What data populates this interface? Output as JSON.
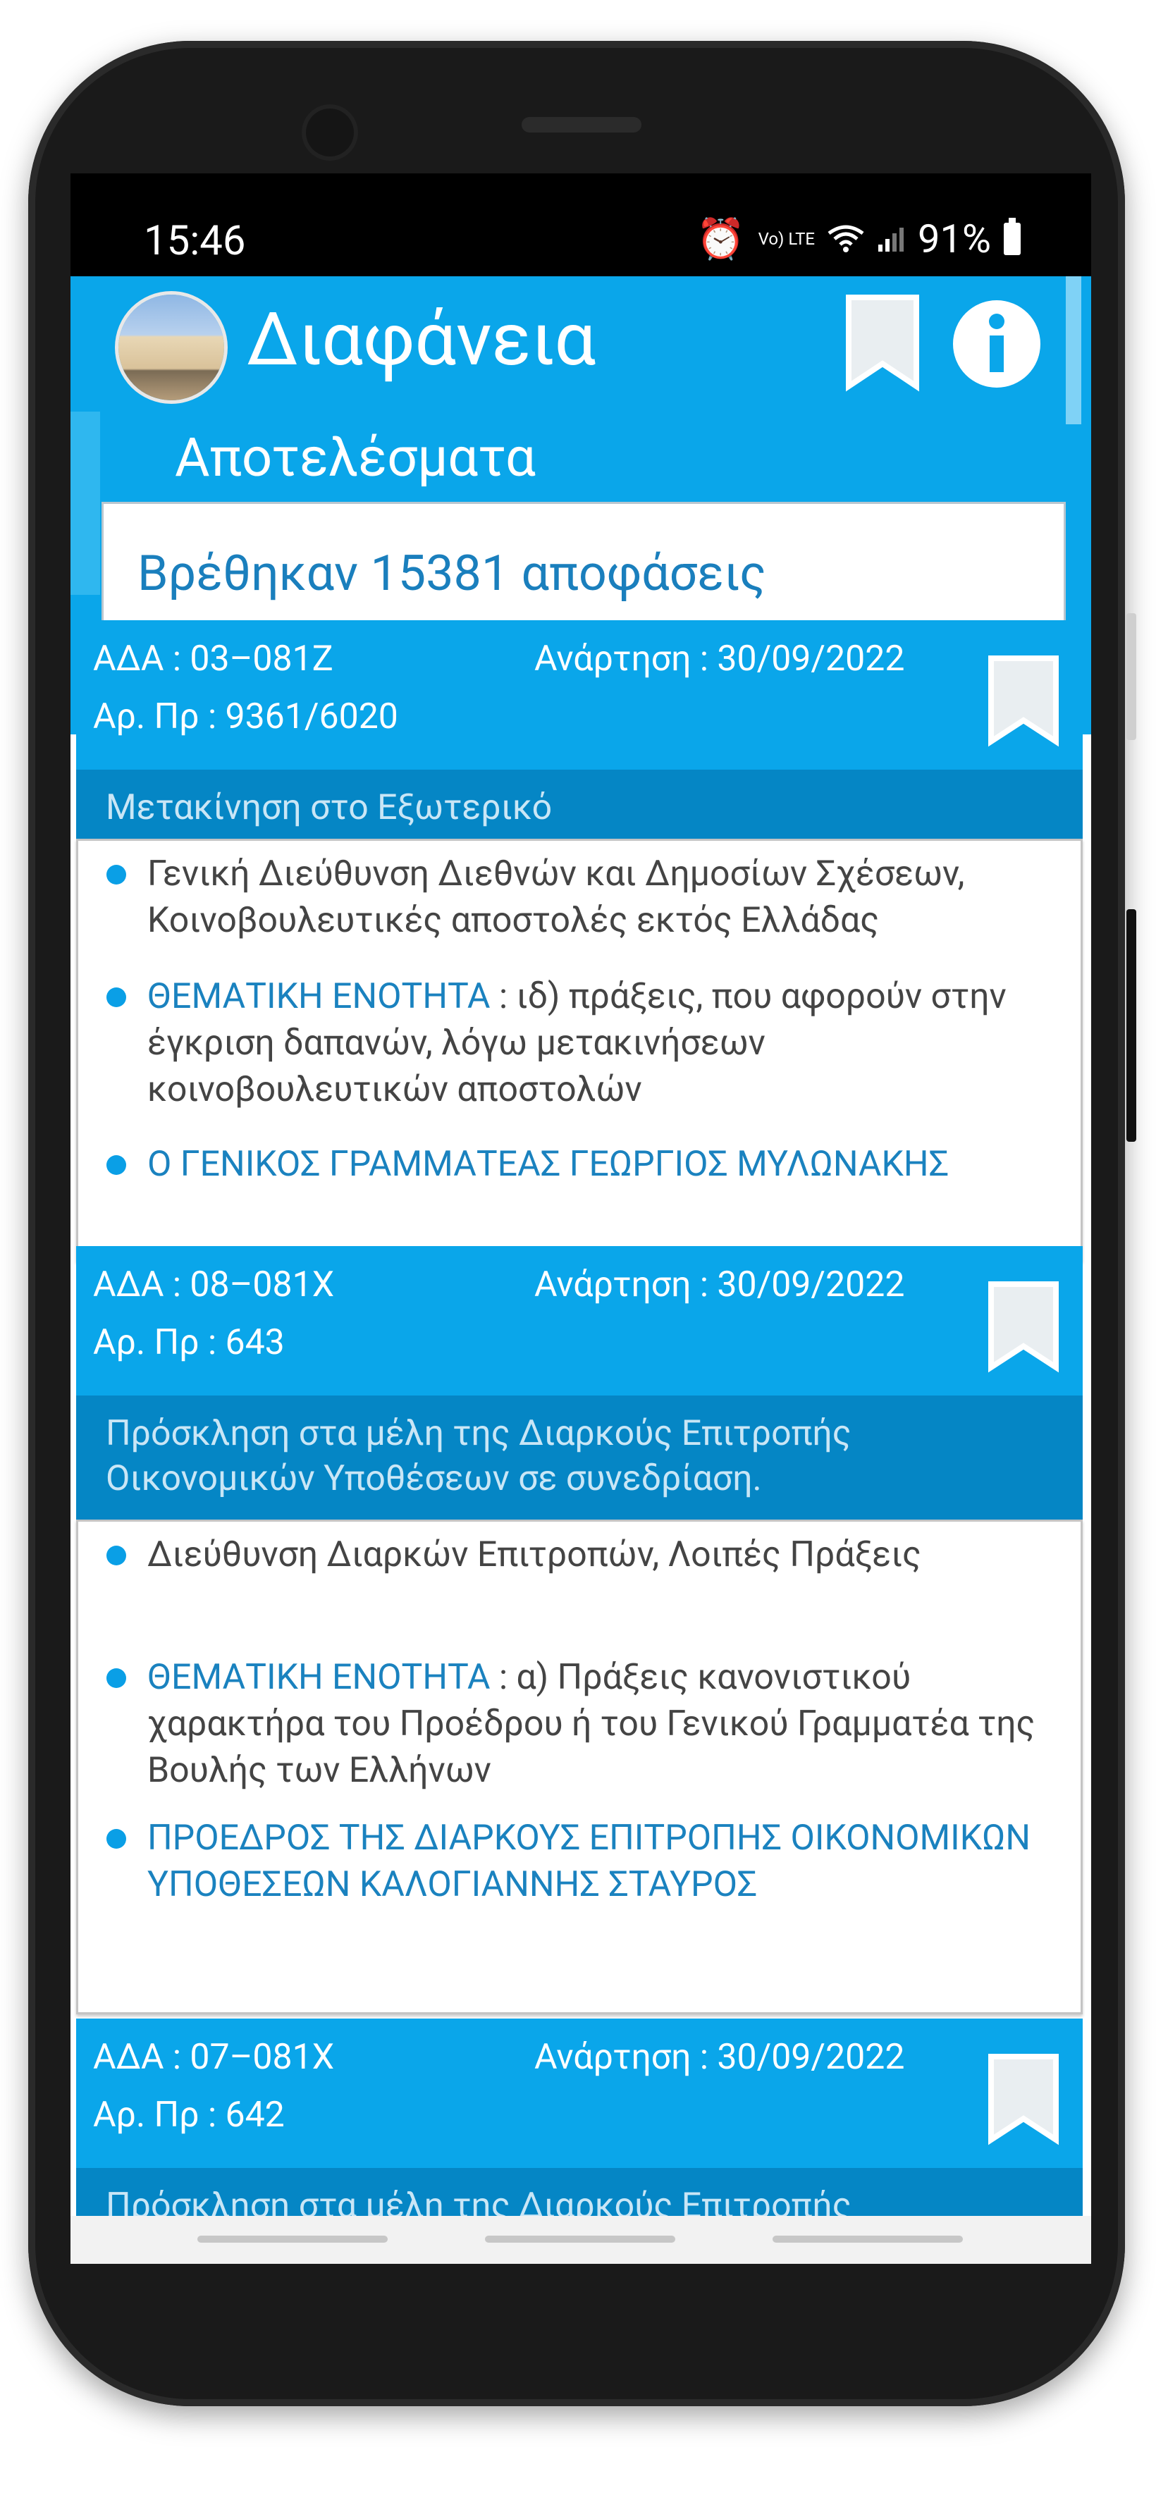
{
  "status": {
    "time": "15:46",
    "network": "Vo) LTE",
    "battery": "91%"
  },
  "app": {
    "title": "Διαφάνεια",
    "bookmark_icon": "bookmark-icon",
    "info_icon": "info-icon",
    "logo": "parliament-logo"
  },
  "results": {
    "title": "Αποτελέσματα",
    "found": "Βρέθηκαν 15381 αποφάσεις"
  },
  "cards": [
    {
      "ada": "ΑΔΑ : 03–081Ζ",
      "ar_pr": "Αρ. Πρ : 9361/6020",
      "posted": "Ανάρτηση : 30/09/2022",
      "subject": "Μετακίνηση στο Εξωτερικό",
      "department": "Γενική Διεύθυνση Διεθνών και Δημοσίων Σχέσεων, Κοινοβουλευτικές αποστολές εκτός Ελλάδας",
      "thematic_label": "ΘΕΜΑΤΙΚΗ ΕΝΟΤΗΤΑ",
      "thematic_text": " : ιδ) πράξεις, που αφορούν στην έγκριση δαπανών, λόγω μετακινήσεων κοινοβουλευτικών αποστολών",
      "signatory": "Ο ΓΕΝΙΚΟΣ ΓΡΑΜΜΑΤΕΑΣ ΓΕΩΡΓΙΟΣ ΜΥΛΩΝΑΚΗΣ"
    },
    {
      "ada": "ΑΔΑ : 08–081Χ",
      "ar_pr": "Αρ. Πρ : 643",
      "posted": "Ανάρτηση : 30/09/2022",
      "subject": "Πρόσκληση στα μέλη της Διαρκούς Επιτροπής Οικονομικών Υποθέσεων σε συνεδρίαση.",
      "department": "Διεύθυνση Διαρκών Επιτροπών, Λοιπές Πράξεις",
      "thematic_label": "ΘΕΜΑΤΙΚΗ ΕΝΟΤΗΤΑ",
      "thematic_text": " : α) Πράξεις κανονιστικού χαρακτήρα του Προέδρου ή του Γενικού Γραμματέα της Βουλής των Ελλήνων",
      "signatory": "ΠΡΟΕΔΡΟΣ ΤΗΣ ΔΙΑΡΚΟΥΣ ΕΠΙΤΡΟΠΗΣ ΟΙΚΟΝΟΜΙΚΩΝ ΥΠΟΘΕΣΕΩΝ ΚΑΛΟΓΙΑΝΝΗΣ ΣΤΑΥΡΟΣ"
    },
    {
      "ada": "ΑΔΑ : 07–081Χ",
      "ar_pr": "Αρ. Πρ : 642",
      "posted": "Ανάρτηση : 30/09/2022",
      "subject": "Πρόσκληση στα μέλη της Διαρκούς Επιτροπής"
    }
  ]
}
